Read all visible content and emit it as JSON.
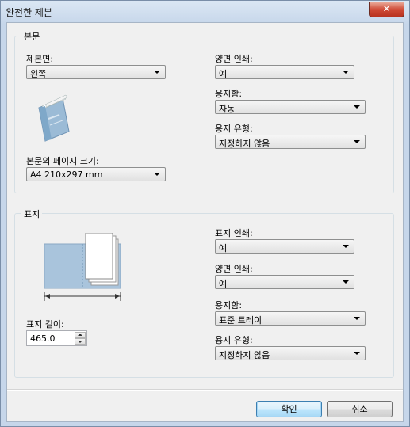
{
  "window": {
    "title": "완전한 제본",
    "close_glyph": "✕"
  },
  "body_group": {
    "title": "본문",
    "binding_edge": {
      "label": "제본면:",
      "value": "왼쪽"
    },
    "duplex": {
      "label": "양면 인쇄:",
      "value": "예"
    },
    "tray": {
      "label": "용지함:",
      "value": "자동"
    },
    "paper_type": {
      "label": "용지 유형:",
      "value": "지정하지 않음"
    },
    "page_size": {
      "label": "본문의 페이지 크기:",
      "value": "A4 210x297 mm"
    }
  },
  "cover_group": {
    "title": "표지",
    "print": {
      "label": "표지 인쇄:",
      "value": "예"
    },
    "duplex": {
      "label": "양면 인쇄:",
      "value": "예"
    },
    "tray": {
      "label": "용지함:",
      "value": "표준 트레이"
    },
    "paper_type": {
      "label": "용지 유형:",
      "value": "지정하지 않음"
    },
    "length": {
      "label": "표지 길이:",
      "value": "465.0"
    }
  },
  "buttons": {
    "ok": "확인",
    "cancel": "취소"
  },
  "colors": {
    "cover_blue": "#a9c4dc",
    "book_blue": "#7fa8c9"
  },
  "icons": [
    "close-icon",
    "book-icon",
    "cover-diagram-icon",
    "chevron-down-icon",
    "spin-up-icon",
    "spin-down-icon"
  ]
}
